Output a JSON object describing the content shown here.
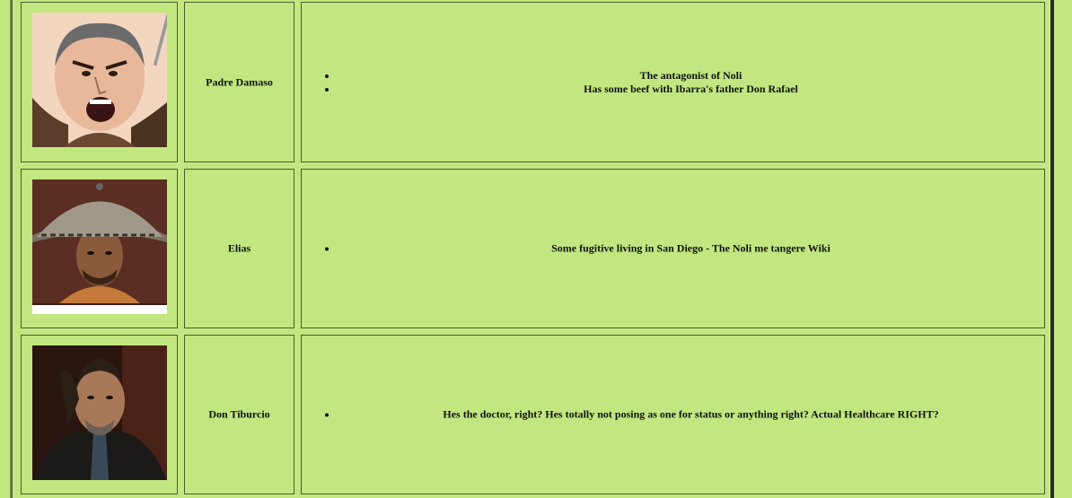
{
  "characters": [
    {
      "name": "Padre Damaso",
      "portrait_icon": "angry-friar-portrait",
      "points": [
        "The antagonist of Noli",
        "Has some beef with Ibarra's father Don Rafael"
      ]
    },
    {
      "name": "Elias",
      "portrait_icon": "salakot-hat-man-portrait",
      "points": [
        "Some fugitive living in San Diego - The Noli me tangere Wiki"
      ]
    },
    {
      "name": "Don Tiburcio",
      "portrait_icon": "bearded-man-photo-portrait",
      "points": [
        "Hes the doctor, right? Hes totally not posing as one for status or anything right? Actual Healthcare RIGHT?"
      ]
    }
  ],
  "colors": {
    "background": "#c2e780",
    "border": "#4d5a2e"
  }
}
